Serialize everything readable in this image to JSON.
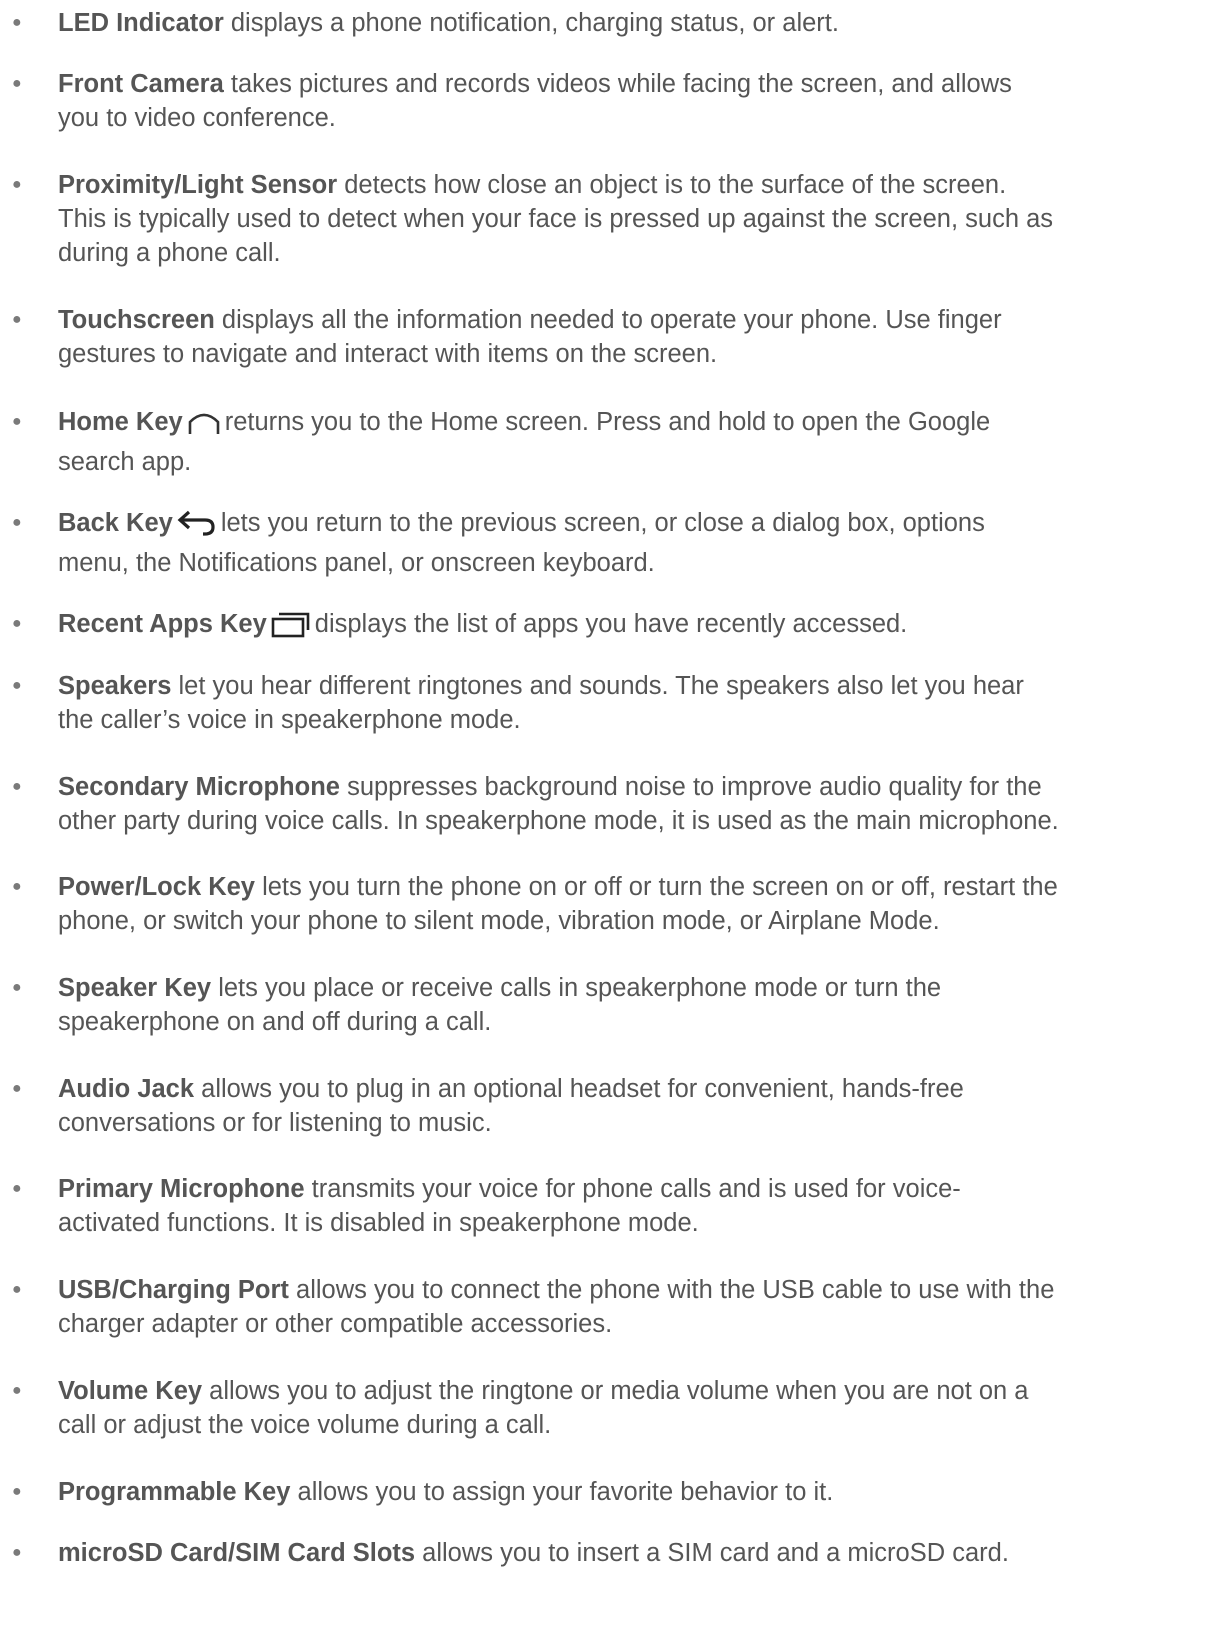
{
  "items": [
    {
      "term": "LED Indicator",
      "lines": [
        " displays a phone notification, charging status, or alert."
      ]
    },
    {
      "term": "Front Camera",
      "lines": [
        " takes pictures and records videos while facing the screen, and allows",
        "you to video conference."
      ]
    },
    {
      "term": "Proximity/Light Sensor",
      "lines": [
        " detects how close an object is to the surface of the screen.",
        "This is typically used to detect when your face is pressed up against the screen, such as",
        "during a phone call."
      ]
    },
    {
      "term": "Touchscreen",
      "lines": [
        " displays all the information needed to operate your phone. Use finger",
        "gestures to navigate and interact with items on the screen."
      ]
    },
    {
      "term": "Home Key",
      "icon": "home-key-icon",
      "lines": [
        "returns you to the Home screen. Press and hold to open the Google",
        "search app."
      ]
    },
    {
      "term": "Back Key",
      "icon": "back-key-icon",
      "lines": [
        "lets you return to the previous screen, or close a dialog box, options",
        "menu, the Notifications panel, or onscreen keyboard."
      ]
    },
    {
      "term": "Recent Apps Key",
      "icon": "recent-apps-key-icon",
      "lines": [
        "displays the list of apps you have recently accessed."
      ]
    },
    {
      "term": "Speakers",
      "lines": [
        " let you hear different ringtones and sounds. The speakers also let you hear",
        "the caller’s voice in speakerphone mode."
      ]
    },
    {
      "term": "Secondary Microphone",
      "lines": [
        " suppresses background noise to improve audio quality for the",
        "other party during voice calls. In speakerphone mode, it is used as the main microphone."
      ]
    },
    {
      "term": "Power/Lock Key",
      "lines": [
        " lets you turn the phone on or off or turn the screen on or off, restart the",
        "phone, or switch your phone to silent mode, vibration mode, or Airplane Mode."
      ]
    },
    {
      "term": "Speaker Key",
      "lines": [
        " lets you place or receive calls in speakerphone mode or turn the",
        "speakerphone on and off during a call."
      ]
    },
    {
      "term": "Audio Jack",
      "lines": [
        " allows you to plug in an optional headset for convenient, hands-free",
        "conversations or for listening to music."
      ]
    },
    {
      "term": "Primary Microphone",
      "lines": [
        " transmits your voice for phone calls and is used for voice-",
        "activated functions. It is disabled in speakerphone mode."
      ]
    },
    {
      "term": "USB/Charging Port",
      "lines": [
        " allows you to connect the phone with the USB cable to use with the",
        "charger adapter or other compatible accessories."
      ]
    },
    {
      "term": "Volume Key",
      "lines": [
        " allows you to adjust the ringtone or media volume when you are not on a",
        "call or adjust the voice volume during a call."
      ]
    },
    {
      "term": "Programmable Key",
      "lines": [
        " allows you to assign your favorite behavior to it."
      ]
    },
    {
      "term": "microSD Card/SIM Card Slots",
      "lines": [
        " allows you to insert a SIM card and a microSD card."
      ]
    }
  ],
  "bullet_glyph": "●",
  "colors": {
    "text": "#555555",
    "bullet": "#7a7a7a",
    "background": "#ffffff"
  }
}
